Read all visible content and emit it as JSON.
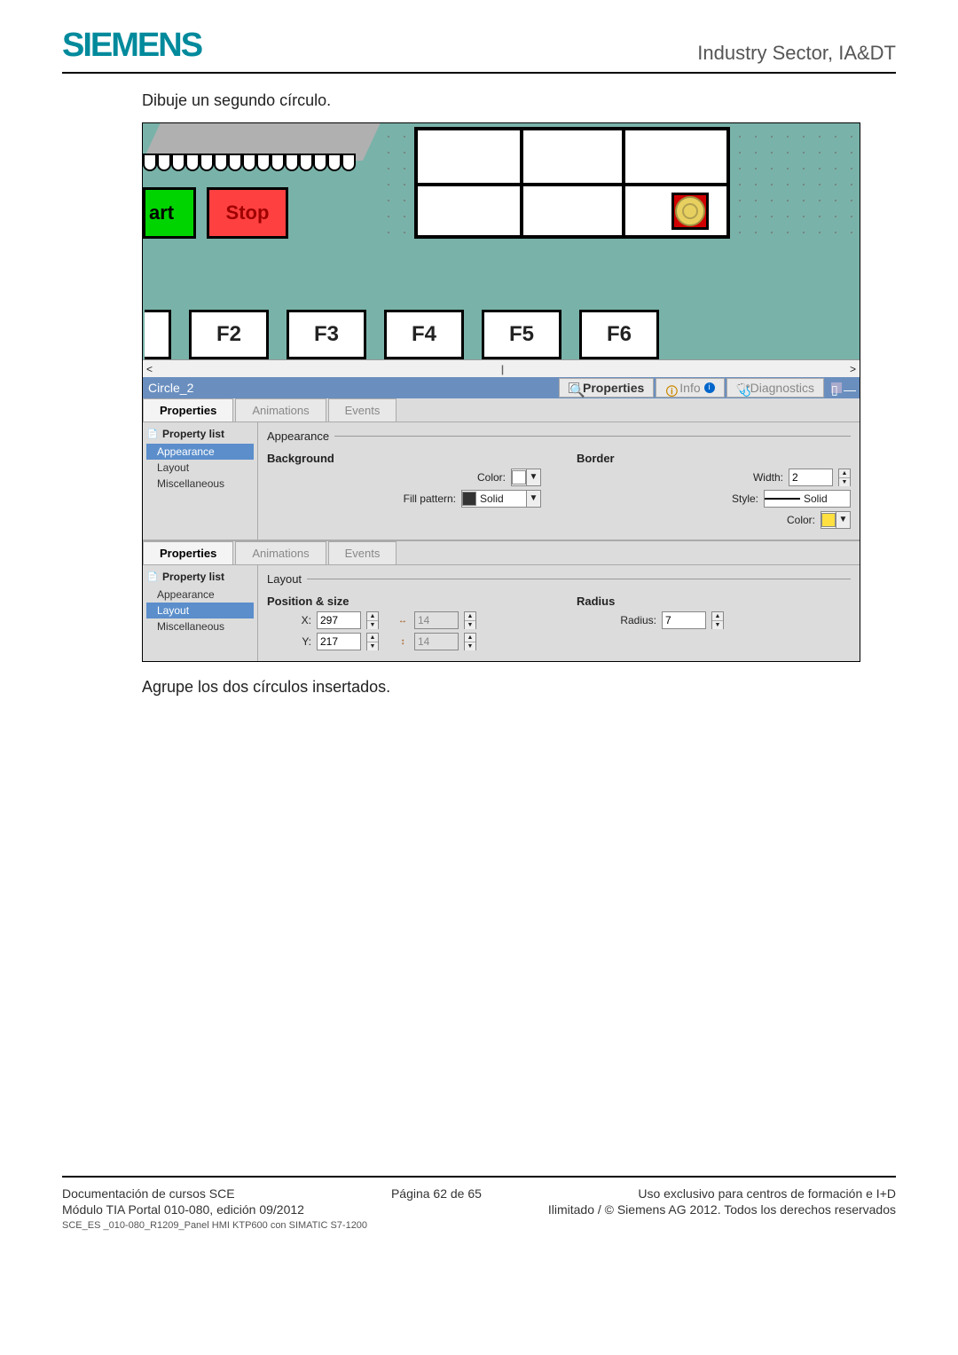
{
  "header": {
    "brand": "SIEMENS",
    "division": "Industry Sector, IA&DT"
  },
  "text": {
    "instr1": "Dibuje un segundo círculo.",
    "instr2": "Agrupe los dos círculos insertados."
  },
  "hmi": {
    "buttons": {
      "start": "art",
      "stop": "Stop"
    },
    "fkeys": [
      "F2",
      "F3",
      "F4",
      "F5",
      "F6"
    ]
  },
  "object_bar": {
    "name": "Circle_2",
    "tabs": {
      "properties": "Properties",
      "info": "Info",
      "diagnostics": "Diagnostics"
    }
  },
  "inspector1": {
    "tabs": [
      "Properties",
      "Animations",
      "Events"
    ],
    "list_header": "Property list",
    "list": [
      "Appearance",
      "Layout",
      "Miscellaneous"
    ],
    "selected": "Appearance",
    "section": "Appearance",
    "background": {
      "heading": "Background",
      "color_label": "Color:",
      "fill_label": "Fill pattern:",
      "fill_value": "Solid"
    },
    "border": {
      "heading": "Border",
      "width_label": "Width:",
      "width_value": "2",
      "style_label": "Style:",
      "style_value": "Solid",
      "color_label": "Color:"
    }
  },
  "inspector2": {
    "tabs": [
      "Properties",
      "Animations",
      "Events"
    ],
    "list_header": "Property list",
    "list": [
      "Appearance",
      "Layout",
      "Miscellaneous"
    ],
    "selected": "Layout",
    "section": "Layout",
    "position": {
      "heading": "Position & size",
      "x_label": "X:",
      "x_value": "297",
      "y_label": "Y:",
      "y_value": "217",
      "w_value": "14",
      "h_value": "14"
    },
    "radius": {
      "heading": "Radius",
      "label": "Radius:",
      "value": "7"
    }
  },
  "footer": {
    "left1": "Documentación de cursos SCE",
    "center": "Página 62 de 65",
    "right1": "Uso exclusivo para centros de formación e I+D",
    "left2": "Módulo TIA Portal 010-080, edición 09/2012",
    "right2": "Ilimitado / © Siemens AG 2012. Todos los derechos reservados",
    "small": "SCE_ES _010-080_R1209_Panel HMI KTP600 con SIMATIC S7-1200"
  }
}
